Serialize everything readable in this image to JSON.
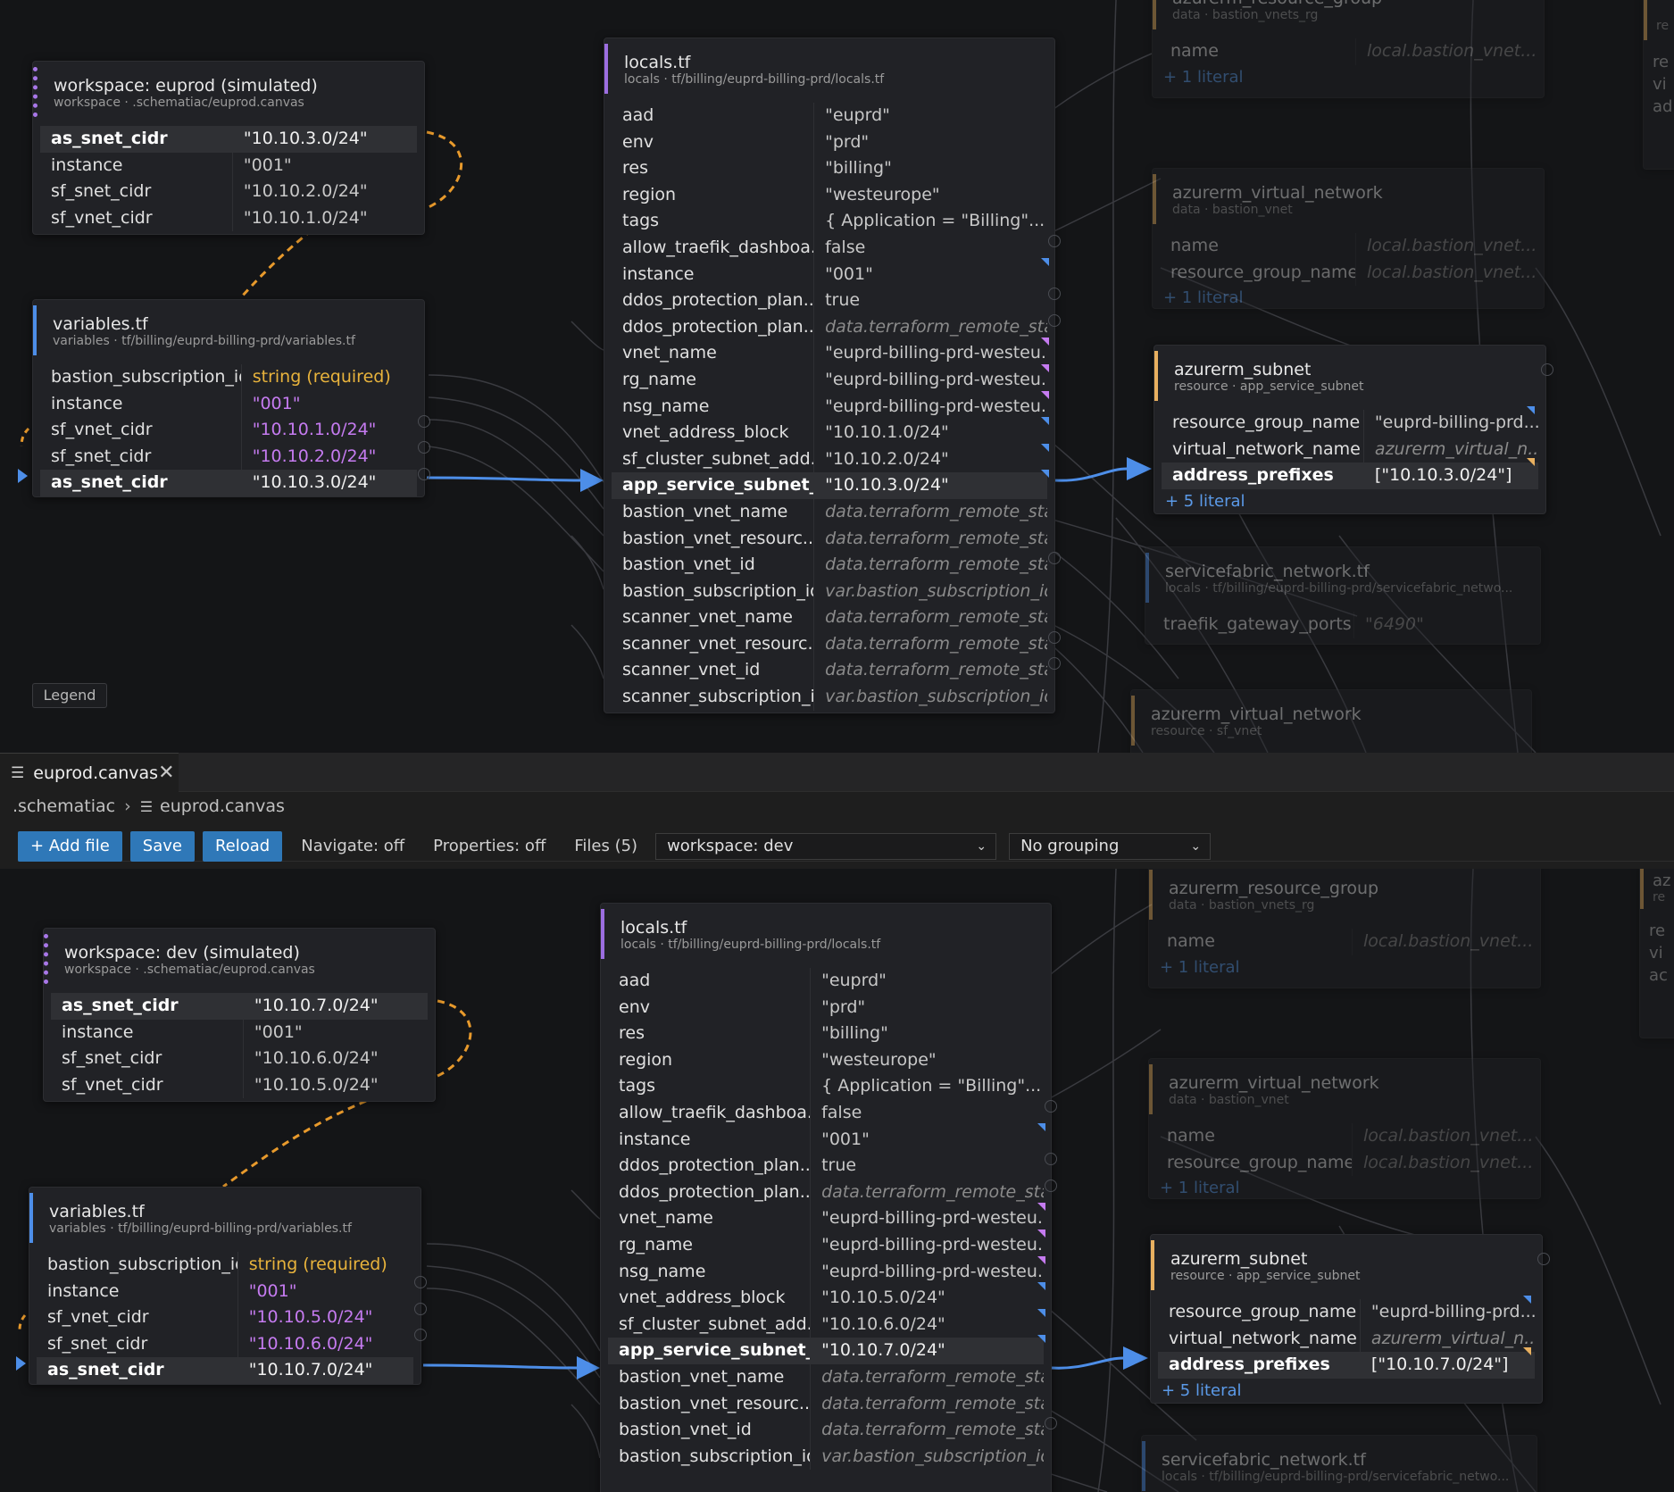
{
  "tab": {
    "name": "euprod.canvas",
    "close": "✕"
  },
  "breadcrumb": {
    "root": ".schematiac",
    "file": "euprod.canvas"
  },
  "toolbar": {
    "add_file": "+ Add file",
    "save": "Save",
    "reload": "Reload",
    "navigate": "Navigate: off",
    "properties": "Properties: off",
    "files": "Files (5)",
    "workspace_select": "workspace: dev",
    "grouping_select": "No grouping"
  },
  "legend": "Legend",
  "top": {
    "workspace": {
      "title": "workspace: euprod (simulated)",
      "sub": "workspace · .schematiac/euprod.canvas",
      "rows": [
        [
          "as_snet_cidr",
          "\"10.10.3.0/24\""
        ],
        [
          "instance",
          "\"001\""
        ],
        [
          "sf_snet_cidr",
          "\"10.10.2.0/24\""
        ],
        [
          "sf_vnet_cidr",
          "\"10.10.1.0/24\""
        ]
      ]
    },
    "variables": {
      "title": "variables.tf",
      "sub": "variables · tf/billing/euprd-billing-prd/variables.tf",
      "rows": [
        [
          "bastion_subscription_id",
          "string (required)"
        ],
        [
          "instance",
          "\"001\""
        ],
        [
          "sf_vnet_cidr",
          "\"10.10.1.0/24\""
        ],
        [
          "sf_snet_cidr",
          "\"10.10.2.0/24\""
        ],
        [
          "as_snet_cidr",
          "\"10.10.3.0/24\""
        ]
      ]
    },
    "locals": {
      "title": "locals.tf",
      "sub": "locals · tf/billing/euprd-billing-prd/locals.tf",
      "rows": [
        [
          "aad",
          "\"euprd\""
        ],
        [
          "env",
          "\"prd\""
        ],
        [
          "res",
          "\"billing\""
        ],
        [
          "region",
          "\"westeurope\""
        ],
        [
          "tags",
          "{ Application = \"Billing\"..."
        ],
        [
          "allow_traefik_dashboa...",
          "false"
        ],
        [
          "instance",
          "\"001\""
        ],
        [
          "ddos_protection_plan...",
          "true"
        ],
        [
          "ddos_protection_plan...",
          "data.terraform_remote_sta..."
        ],
        [
          "vnet_name",
          "\"euprd-billing-prd-westeu..."
        ],
        [
          "rg_name",
          "\"euprd-billing-prd-westeu..."
        ],
        [
          "nsg_name",
          "\"euprd-billing-prd-westeu..."
        ],
        [
          "vnet_address_block",
          "\"10.10.1.0/24\""
        ],
        [
          "sf_cluster_subnet_add...",
          "\"10.10.2.0/24\""
        ],
        [
          "app_service_subnet_...",
          "\"10.10.3.0/24\""
        ],
        [
          "bastion_vnet_name",
          "data.terraform_remote_sta..."
        ],
        [
          "bastion_vnet_resourc...",
          "data.terraform_remote_sta..."
        ],
        [
          "bastion_vnet_id",
          "data.terraform_remote_sta..."
        ],
        [
          "bastion_subscription_id",
          "var.bastion_subscription_id"
        ],
        [
          "scanner_vnet_name",
          "data.terraform_remote_sta..."
        ],
        [
          "scanner_vnet_resourc...",
          "data.terraform_remote_sta..."
        ],
        [
          "scanner_vnet_id",
          "data.terraform_remote_sta..."
        ],
        [
          "scanner_subscription_id",
          "var.bastion_subscription_id"
        ]
      ]
    },
    "rg": {
      "title": "azurerm_resource_group",
      "sub": "data · bastion_vnets_rg",
      "rows": [
        [
          "name",
          "local.bastion_vnet..."
        ]
      ],
      "literal": "+ 1 literal"
    },
    "vnet_bastion": {
      "title": "azurerm_virtual_network",
      "sub": "data · bastion_vnet",
      "rows": [
        [
          "name",
          "local.bastion_vnet..."
        ],
        [
          "resource_group_name",
          "local.bastion_vnet..."
        ]
      ],
      "literal": "+ 1 literal"
    },
    "subnet": {
      "title": "azurerm_subnet",
      "sub": "resource · app_service_subnet",
      "rows": [
        [
          "resource_group_name",
          "\"euprd-billing-prd..."
        ],
        [
          "virtual_network_name",
          "azurerm_virtual_n..."
        ],
        [
          "address_prefixes",
          "[\"10.10.3.0/24\"]"
        ]
      ],
      "literal": "+ 5 literal"
    },
    "sf_network": {
      "title": "servicefabric_network.tf",
      "sub": "locals · tf/billing/euprd-billing-prd/servicefabric_netwo...",
      "rows": [
        [
          "traefik_gateway_ports",
          "\"6490\""
        ]
      ]
    },
    "vnet_sf": {
      "title": "azurerm_virtual_network",
      "sub": "resource · sf_vnet"
    },
    "edge_right": {
      "t1": "re",
      "t2": "re",
      "t3": "vi",
      "t4": "ad"
    }
  },
  "bottom": {
    "workspace": {
      "title": "workspace: dev (simulated)",
      "sub": "workspace · .schematiac/euprod.canvas",
      "rows": [
        [
          "as_snet_cidr",
          "\"10.10.7.0/24\""
        ],
        [
          "instance",
          "\"001\""
        ],
        [
          "sf_snet_cidr",
          "\"10.10.6.0/24\""
        ],
        [
          "sf_vnet_cidr",
          "\"10.10.5.0/24\""
        ]
      ]
    },
    "variables": {
      "title": "variables.tf",
      "sub": "variables · tf/billing/euprd-billing-prd/variables.tf",
      "rows": [
        [
          "bastion_subscription_id",
          "string (required)"
        ],
        [
          "instance",
          "\"001\""
        ],
        [
          "sf_vnet_cidr",
          "\"10.10.5.0/24\""
        ],
        [
          "sf_snet_cidr",
          "\"10.10.6.0/24\""
        ],
        [
          "as_snet_cidr",
          "\"10.10.7.0/24\""
        ]
      ]
    },
    "locals": {
      "title": "locals.tf",
      "sub": "locals · tf/billing/euprd-billing-prd/locals.tf",
      "rows": [
        [
          "aad",
          "\"euprd\""
        ],
        [
          "env",
          "\"prd\""
        ],
        [
          "res",
          "\"billing\""
        ],
        [
          "region",
          "\"westeurope\""
        ],
        [
          "tags",
          "{ Application = \"Billing\"..."
        ],
        [
          "allow_traefik_dashboa...",
          "false"
        ],
        [
          "instance",
          "\"001\""
        ],
        [
          "ddos_protection_plan...",
          "true"
        ],
        [
          "ddos_protection_plan...",
          "data.terraform_remote_sta..."
        ],
        [
          "vnet_name",
          "\"euprd-billing-prd-westeu..."
        ],
        [
          "rg_name",
          "\"euprd-billing-prd-westeu..."
        ],
        [
          "nsg_name",
          "\"euprd-billing-prd-westeu..."
        ],
        [
          "vnet_address_block",
          "\"10.10.5.0/24\""
        ],
        [
          "sf_cluster_subnet_add...",
          "\"10.10.6.0/24\""
        ],
        [
          "app_service_subnet_...",
          "\"10.10.7.0/24\""
        ],
        [
          "bastion_vnet_name",
          "data.terraform_remote_sta..."
        ],
        [
          "bastion_vnet_resourc...",
          "data.terraform_remote_sta..."
        ],
        [
          "bastion_vnet_id",
          "data.terraform_remote_sta..."
        ],
        [
          "bastion_subscription_id",
          "var.bastion_subscription_id"
        ]
      ]
    },
    "rg": {
      "title": "azurerm_resource_group",
      "sub": "data · bastion_vnets_rg",
      "rows": [
        [
          "name",
          "local.bastion_vnet..."
        ]
      ],
      "literal": "+ 1 literal"
    },
    "vnet_bastion": {
      "title": "azurerm_virtual_network",
      "sub": "data · bastion_vnet",
      "rows": [
        [
          "name",
          "local.bastion_vnet..."
        ],
        [
          "resource_group_name",
          "local.bastion_vnet..."
        ]
      ],
      "literal": "+ 1 literal"
    },
    "subnet": {
      "title": "azurerm_subnet",
      "sub": "resource · app_service_subnet",
      "rows": [
        [
          "resource_group_name",
          "\"euprd-billing-prd..."
        ],
        [
          "virtual_network_name",
          "azurerm_virtual_n..."
        ],
        [
          "address_prefixes",
          "[\"10.10.7.0/24\"]"
        ]
      ],
      "literal": "+ 5 literal"
    },
    "sf_network": {
      "title": "servicefabric_network.tf",
      "sub": "locals · tf/billing/euprd-billing-prd/servicefabric_netwo..."
    },
    "edge_right": {
      "t0": "az",
      "t1": "re",
      "t2": "re",
      "t3": "vi",
      "t4": "ac"
    }
  },
  "colors": {
    "accent": "#4d8ee8",
    "warning": "#e8b33c",
    "magenta": "#c57bf0",
    "wire_orange": "#e89a2c",
    "bg": "#141517"
  },
  "icons": {
    "file": "file-lines-icon",
    "close": "close-icon",
    "chevron": "chevron-down-icon",
    "crumb_sep": "chevron-right-icon"
  }
}
